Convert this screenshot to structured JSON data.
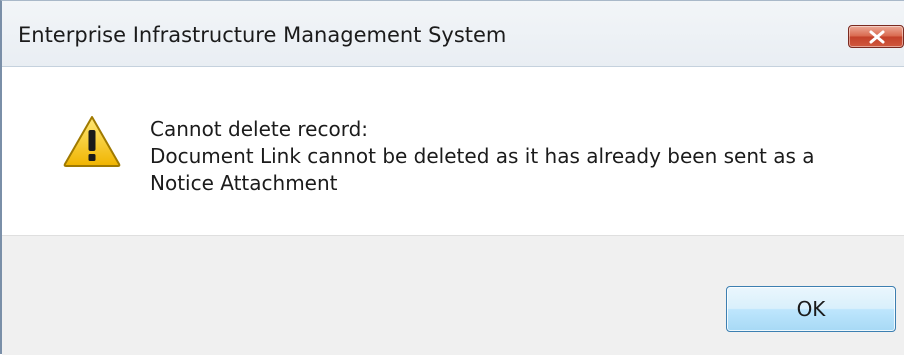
{
  "window": {
    "title": "Enterprise Infrastructure Management System",
    "close_icon": "close-icon"
  },
  "message": {
    "icon": "warning-icon",
    "heading": "Cannot delete record:",
    "body": "Document Link cannot be deleted as it has already been sent as a\nNotice Attachment"
  },
  "buttons": {
    "ok_label": "OK"
  },
  "colors": {
    "warning_fill": "#f5c400",
    "close_button": "#c3412a",
    "ok_border": "#3c7fb1"
  }
}
